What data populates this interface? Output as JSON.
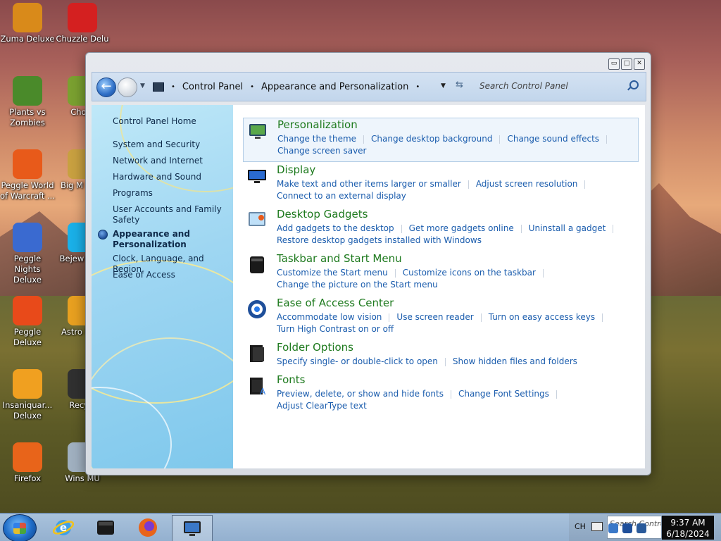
{
  "desktop": {
    "icons": [
      {
        "label": "Zuma Deluxe",
        "icon": "zuma-icon",
        "color": "#d98a1a"
      },
      {
        "label": "Chuzzle Delu",
        "icon": "chuzzle-icon",
        "color": "#d42020"
      },
      {
        "label": "Plants vs Zombies",
        "icon": "plants-vs-zombies-icon",
        "color": "#4a8a2a"
      },
      {
        "label": "Chom",
        "icon": "chomp-icon",
        "color": "#7aa030"
      },
      {
        "label": "Peggle World of Warcraft ...",
        "icon": "peggle-wow-icon",
        "color": "#e85a1a"
      },
      {
        "label": "Big M Delu",
        "icon": "bigmoney-icon",
        "color": "#c8a040"
      },
      {
        "label": "Peggle Nights Deluxe",
        "icon": "peggle-nights-icon",
        "color": "#3a6ad0"
      },
      {
        "label": "Bejew Delu",
        "icon": "bejeweled-icon",
        "color": "#1ab0e8"
      },
      {
        "label": "Peggle Deluxe",
        "icon": "peggle-icon",
        "color": "#e84a1a"
      },
      {
        "label": "Astro Delu",
        "icon": "astropop-icon",
        "color": "#e8a020"
      },
      {
        "label": "Insaniquar... Deluxe",
        "icon": "insaniquarium-icon",
        "color": "#f0a020"
      },
      {
        "label": "Recycl",
        "icon": "recycle-bin-icon",
        "color": "#303030"
      },
      {
        "label": "Firefox",
        "icon": "firefox-icon",
        "color": "#e8641a"
      },
      {
        "label": "Wins MU",
        "icon": "winsmu-icon",
        "color": "#a0b0c0"
      }
    ]
  },
  "window": {
    "caption": {
      "minimize": "▭",
      "maximize": "□",
      "close": "✕"
    },
    "nav": {
      "back_glyph": "←",
      "breadcrumb": [
        "Control Panel",
        "Appearance and Personalization"
      ],
      "sep": "•",
      "search_placeholder": "Search Control Panel"
    },
    "sidebar": {
      "items": [
        {
          "label": "Control Panel Home"
        },
        {
          "label": "System and Security"
        },
        {
          "label": "Network and Internet"
        },
        {
          "label": "Hardware and Sound"
        },
        {
          "label": "Programs"
        },
        {
          "label": "User Accounts and Family Safety"
        },
        {
          "label": "Appearance and Personalization"
        },
        {
          "label": "Clock, Language, and Region"
        },
        {
          "label": "Ease of Access"
        }
      ]
    },
    "categories": [
      {
        "title": "Personalization",
        "icon": "personalization-icon",
        "links": [
          "Change the theme",
          "Change desktop background",
          "Change sound effects",
          "Change screen saver"
        ]
      },
      {
        "title": "Display",
        "icon": "display-icon",
        "links": [
          "Make text and other items larger or smaller",
          "Adjust screen resolution",
          "Connect to an external display"
        ]
      },
      {
        "title": "Desktop Gadgets",
        "icon": "desktop-gadgets-icon",
        "links": [
          "Add gadgets to the desktop",
          "Get more gadgets online",
          "Uninstall a gadget",
          "Restore desktop gadgets installed with Windows"
        ]
      },
      {
        "title": "Taskbar and Start Menu",
        "icon": "taskbar-icon",
        "links": [
          "Customize the Start menu",
          "Customize icons on the taskbar",
          "Change the picture on the Start menu"
        ]
      },
      {
        "title": "Ease of Access Center",
        "icon": "ease-of-access-icon",
        "links": [
          "Accommodate low vision",
          "Use screen reader",
          "Turn on easy access keys",
          "Turn High Contrast on or off"
        ]
      },
      {
        "title": "Folder Options",
        "icon": "folder-options-icon",
        "links": [
          "Specify single- or double-click to open",
          "Show hidden files and folders"
        ]
      },
      {
        "title": "Fonts",
        "icon": "fonts-icon",
        "links": [
          "Preview, delete, or show and hide fonts",
          "Change Font Settings",
          "Adjust ClearType text"
        ]
      }
    ]
  },
  "taskbar": {
    "items": [
      {
        "name": "internet-explorer-icon"
      },
      {
        "name": "media-center-icon"
      },
      {
        "name": "firefox-icon"
      },
      {
        "name": "control-panel-icon"
      }
    ],
    "tray": {
      "lang": "CH",
      "search_placeholder": "Search Contro",
      "time": "9:37 AM",
      "date": "6/18/2024"
    }
  },
  "colors": {
    "link": "#1a5cad",
    "category_title": "#1e7a1e",
    "sidebar_text": "#0e2a4a"
  }
}
